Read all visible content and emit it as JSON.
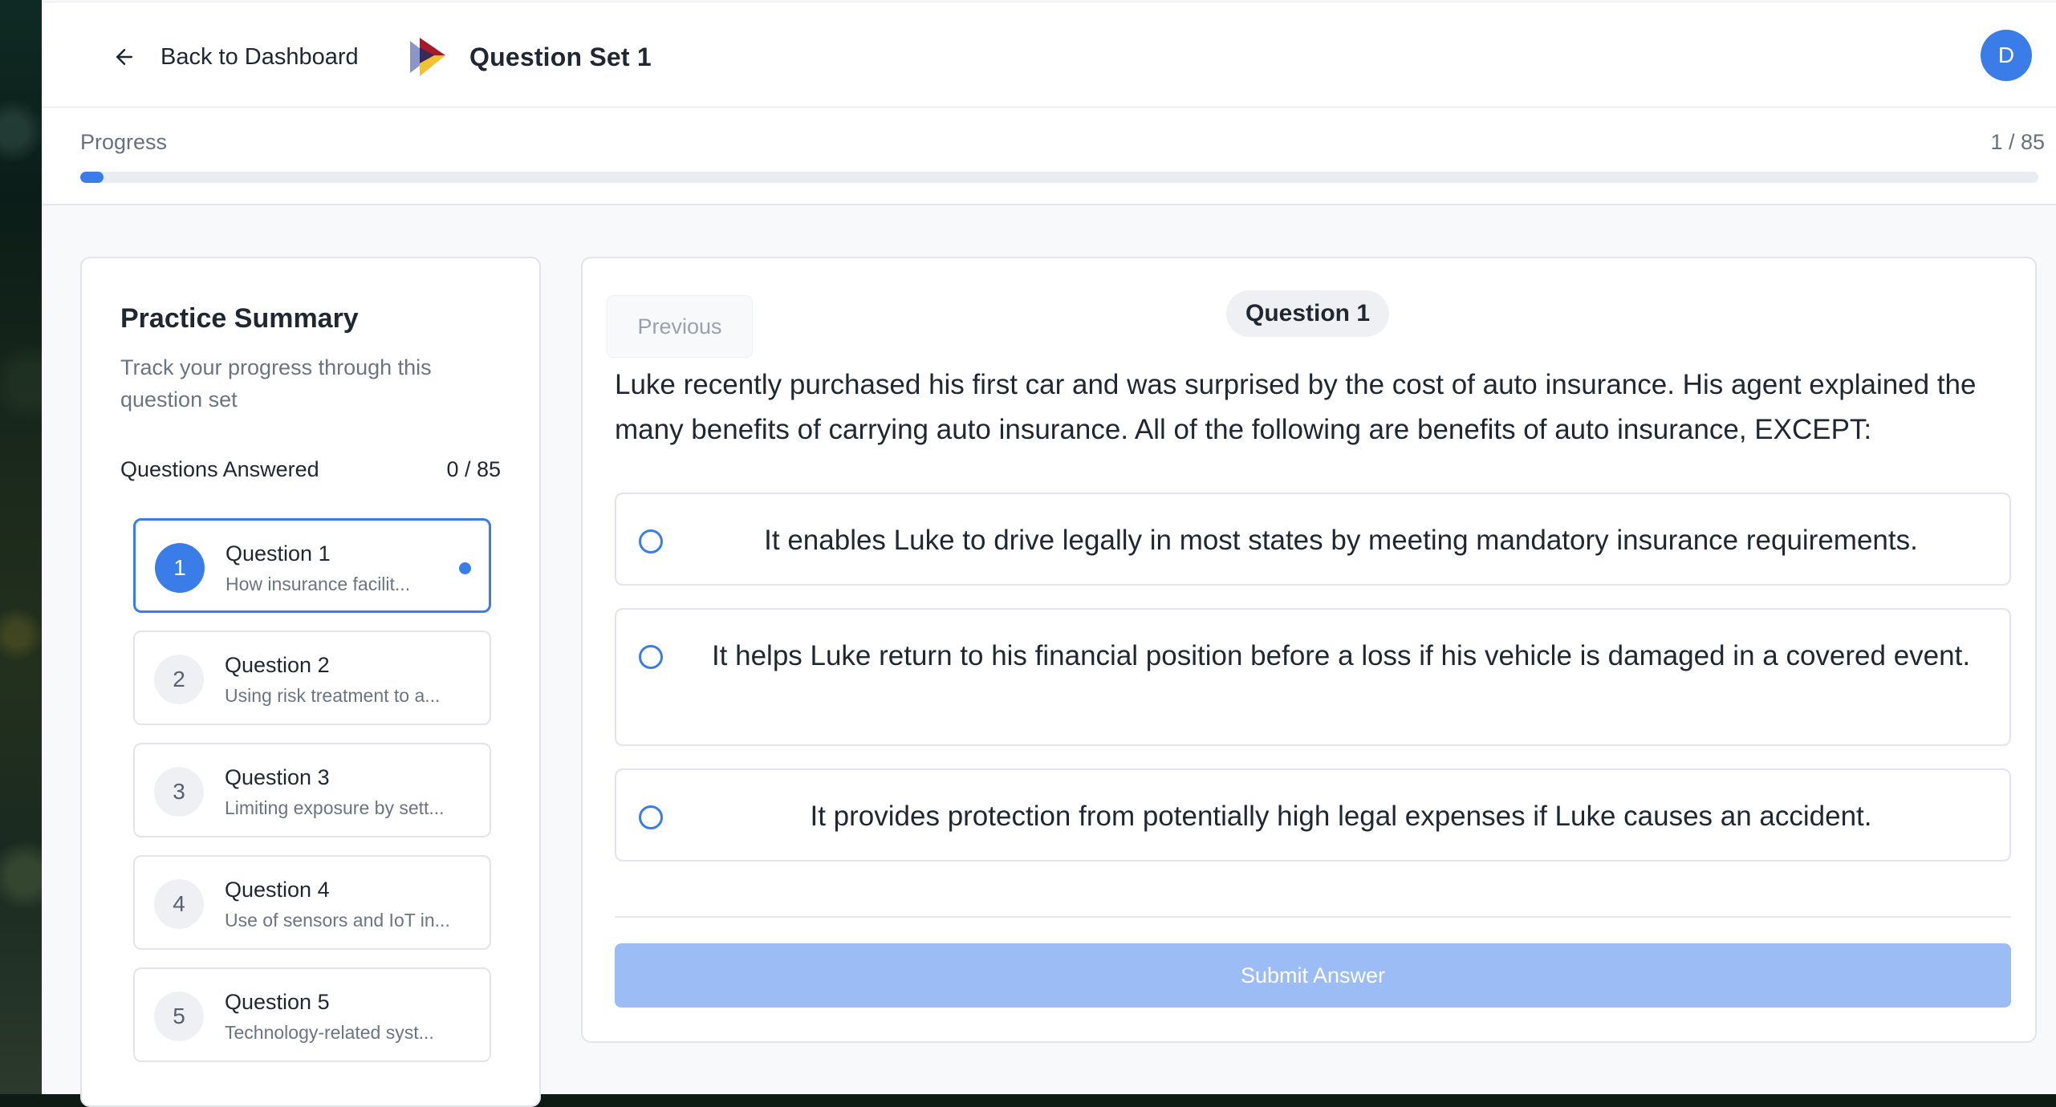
{
  "header": {
    "back_label": "Back to Dashboard",
    "title": "Question Set 1",
    "avatar_initial": "D"
  },
  "progress": {
    "label": "Progress",
    "count": "1 / 85",
    "current": 1,
    "total": 85
  },
  "sidebar": {
    "title": "Practice Summary",
    "subtitle": "Track your progress through this question set",
    "answered_label": "Questions Answered",
    "answered_count": "0 / 85",
    "questions": [
      {
        "num": "1",
        "title": "Question 1",
        "snippet": "How insurance facilit...",
        "active": true
      },
      {
        "num": "2",
        "title": "Question 2",
        "snippet": "Using risk treatment to a...",
        "active": false
      },
      {
        "num": "3",
        "title": "Question 3",
        "snippet": "Limiting exposure by sett...",
        "active": false
      },
      {
        "num": "4",
        "title": "Question 4",
        "snippet": "Use of sensors and IoT in...",
        "active": false
      },
      {
        "num": "5",
        "title": "Question 5",
        "snippet": "Technology-related syst...",
        "active": false
      }
    ]
  },
  "main": {
    "previous_label": "Previous",
    "question_badge": "Question 1",
    "question_text": "Luke recently purchased his first car and was surprised by the cost of auto insurance. His agent explained the many benefits of carrying auto insurance. All of the following are benefits of auto insurance, EXCEPT:",
    "options": [
      "It enables Luke to drive legally in most states by meeting mandatory insurance requirements.",
      "It helps Luke return to his financial position before a loss if his vehicle is damaged in a covered event.",
      "It provides protection from potentially high legal expenses if Luke causes an accident."
    ],
    "submit_label": "Submit Answer"
  },
  "colors": {
    "accent": "#3b7de8",
    "submit_disabled": "#9cbcf5"
  }
}
